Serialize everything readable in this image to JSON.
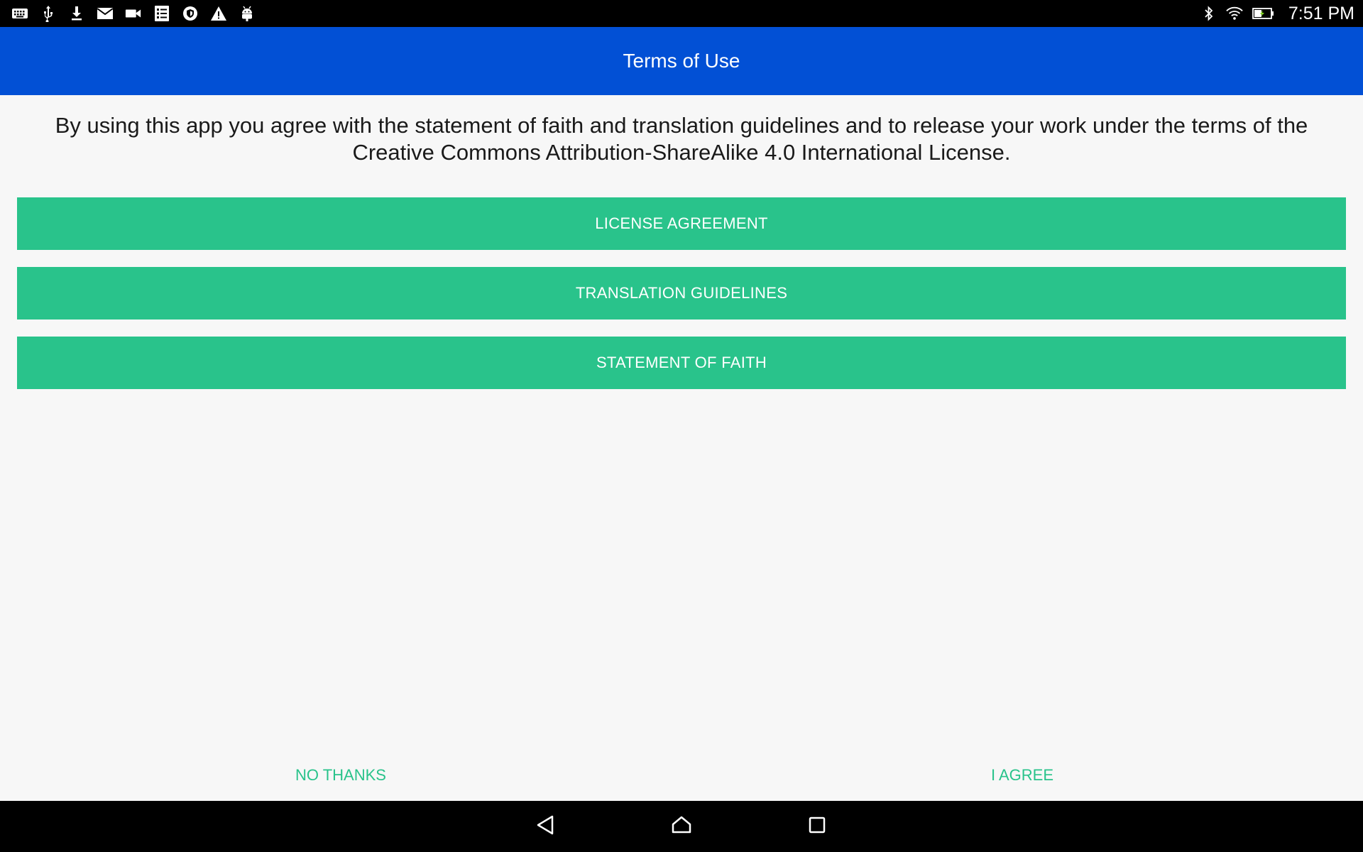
{
  "status_bar": {
    "left_icons": [
      "keyboard-icon",
      "usb-icon",
      "download-icon",
      "mail-icon",
      "video-camera-icon",
      "task-list-icon",
      "shield-icon",
      "warning-icon",
      "android-icon"
    ],
    "right_icons": [
      "bluetooth-icon",
      "wifi-icon",
      "battery-charging-icon"
    ],
    "time": "7:51 PM"
  },
  "app_bar": {
    "title": "Terms of Use",
    "color": "#0250d5"
  },
  "intro": {
    "text": "By using this app you agree with the statement of faith and translation guidelines and to release your work under the terms of the Creative Commons Attribution-ShareAlike 4.0 International License."
  },
  "documents": {
    "license_label": "LICENSE AGREEMENT",
    "guidelines_label": "TRANSLATION GUIDELINES",
    "faith_label": "STATEMENT OF FAITH",
    "button_color": "#29c38b"
  },
  "actions": {
    "decline_label": "NO THANKS",
    "accept_label": "I AGREE"
  },
  "navigation": {
    "icons": [
      "back-icon",
      "home-icon",
      "recents-icon"
    ]
  }
}
